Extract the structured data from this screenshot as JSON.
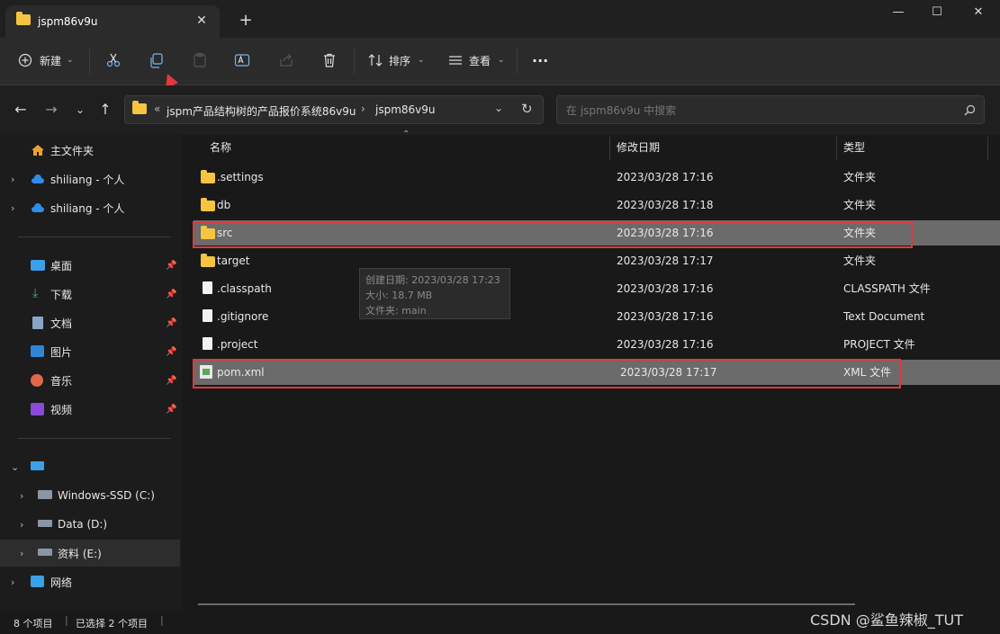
{
  "window": {
    "tab_title": "jspm86v9u",
    "tab_close": "✕",
    "new_tab": "+",
    "minimize": "—",
    "maximize": "☐",
    "close": "✕"
  },
  "toolbar": {
    "new_label": "新建",
    "sort_label": "排序",
    "view_label": "查看",
    "more": "···"
  },
  "address": {
    "overflow": "«",
    "crumbs": [
      "jspm产品结构树的产品报价系统86v9u",
      "jspm86v9u"
    ],
    "sep": "›"
  },
  "search": {
    "placeholder": "在 jspm86v9u 中搜索"
  },
  "sidebar": {
    "home": "主文件夹",
    "cloud1": "shiliang - 个人",
    "cloud2": "shiliang - 个人",
    "quick": [
      "桌面",
      "下载",
      "文档",
      "图片",
      "音乐",
      "视频"
    ],
    "drives": [
      "Windows-SSD (C:)",
      "Data (D:)",
      "资料 (E:)"
    ],
    "network": "网络"
  },
  "columns": {
    "name": "名称",
    "date": "修改日期",
    "type": "类型"
  },
  "files": [
    {
      "name": ".settings",
      "date": "2023/03/28 17:16",
      "type": "文件夹",
      "kind": "folder"
    },
    {
      "name": "db",
      "date": "2023/03/28 17:18",
      "type": "文件夹",
      "kind": "folder"
    },
    {
      "name": "src",
      "date": "2023/03/28 17:16",
      "type": "文件夹",
      "kind": "folder"
    },
    {
      "name": "target",
      "date": "2023/03/28 17:17",
      "type": "文件夹",
      "kind": "folder"
    },
    {
      "name": ".classpath",
      "date": "2023/03/28 17:16",
      "type": "CLASSPATH 文件",
      "kind": "file"
    },
    {
      "name": ".gitignore",
      "date": "2023/03/28 17:16",
      "type": "Text Document",
      "kind": "file"
    },
    {
      "name": ".project",
      "date": "2023/03/28 17:16",
      "type": "PROJECT 文件",
      "kind": "file"
    },
    {
      "name": "pom.xml",
      "date": "2023/03/28 17:17",
      "type": "XML 文件",
      "kind": "xml"
    }
  ],
  "tooltip": {
    "line1": "创建日期: 2023/03/28 17:23",
    "line2": "大小: 18.7 MB",
    "line3": "文件夹: main"
  },
  "status": {
    "count": "8 个项目",
    "selected": "已选择 2 个项目"
  },
  "watermark": "CSDN @鲨鱼辣椒_TUT",
  "colors": {
    "highlight": "#e0393e",
    "selection": "#6b6b6b",
    "folder": "#f5c542"
  }
}
